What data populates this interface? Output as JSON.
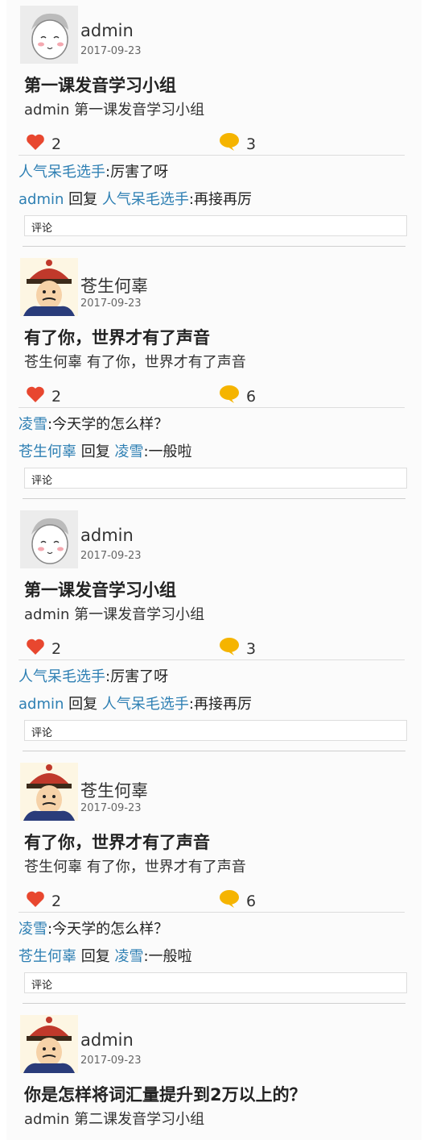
{
  "posts": [
    {
      "user": "admin",
      "date": "2017-09-23",
      "avatar": "sketch-avatar",
      "title": "第一课发音学习小组",
      "desc": "admin 第一课发音学习小组",
      "likes": "2",
      "comments_count": "3",
      "comments": [
        {
          "user": "人气呆毛选手",
          "sep": ":",
          "text": "厉害了呀"
        },
        {
          "user": "admin",
          "reply": "回复",
          "to": "人气呆毛选手",
          "sep": ":",
          "text": "再接再厉"
        }
      ],
      "comment_label": "评论"
    },
    {
      "user": "苍生何辜",
      "date": "2017-09-23",
      "avatar": "qing-official-avatar",
      "title": "有了你，世界才有了声音",
      "desc": "苍生何辜 有了你，世界才有了声音",
      "likes": "2",
      "comments_count": "6",
      "comments": [
        {
          "user": "凌雪",
          "sep": ":",
          "text": "今天学的怎么样？"
        },
        {
          "user": "苍生何辜",
          "reply": "回复",
          "to": "凌雪",
          "sep": ":",
          "text": "一般啦"
        }
      ],
      "comment_label": "评论"
    },
    {
      "user": "admin",
      "date": "2017-09-23",
      "avatar": "sketch-avatar",
      "title": "第一课发音学习小组",
      "desc": "admin 第一课发音学习小组",
      "likes": "2",
      "comments_count": "3",
      "comments": [
        {
          "user": "人气呆毛选手",
          "sep": ":",
          "text": "厉害了呀"
        },
        {
          "user": "admin",
          "reply": "回复",
          "to": "人气呆毛选手",
          "sep": ":",
          "text": "再接再厉"
        }
      ],
      "comment_label": "评论"
    },
    {
      "user": "苍生何辜",
      "date": "2017-09-23",
      "avatar": "qing-official-avatar",
      "title": "有了你，世界才有了声音",
      "desc": "苍生何辜 有了你，世界才有了声音",
      "likes": "2",
      "comments_count": "6",
      "comments": [
        {
          "user": "凌雪",
          "sep": ":",
          "text": "今天学的怎么样？"
        },
        {
          "user": "苍生何辜",
          "reply": "回复",
          "to": "凌雪",
          "sep": ":",
          "text": "一般啦"
        }
      ],
      "comment_label": "评论"
    },
    {
      "user": "admin",
      "date": "2017-09-23",
      "avatar": "qing-official-avatar",
      "title": "你是怎样将词汇量提升到2万以上的？",
      "desc": "admin 第二课发音学习小组"
    }
  ],
  "colors": {
    "link": "#2d7fb3",
    "heart": "#e8472f",
    "bubble": "#f5b400"
  },
  "icons": {
    "like": "heart-icon",
    "comment": "speech-bubble-icon"
  }
}
